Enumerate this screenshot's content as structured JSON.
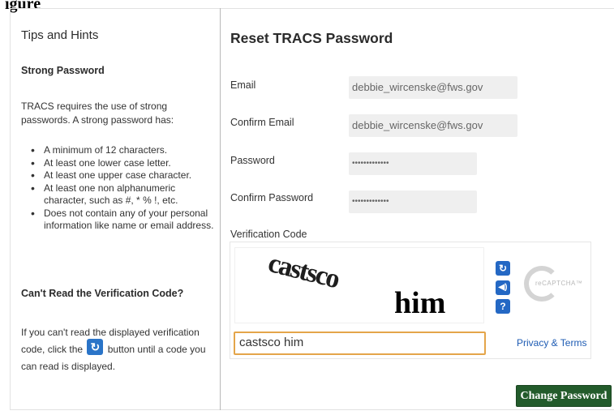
{
  "figure_label": "igure",
  "sidebar": {
    "title": "Tips and Hints",
    "strong_title": "Strong Password",
    "intro": "TRACS requires the use of strong passwords. A strong password has:",
    "bullets": [
      "A minimum of 12 characters.",
      "At least one lower case letter.",
      "At least one upper case character.",
      "At least one non alphanumeric character, such as #, * % !, etc.",
      "Does not contain any of your personal information like name or email address."
    ],
    "cant_read_title": "Can't Read the Verification Code?",
    "help_before": "If you can't read the displayed verification code, click the",
    "help_after": "button until a code you can read is displayed.",
    "refresh_icon": "refresh-icon"
  },
  "form": {
    "title": "Reset TRACS Password",
    "email_label": "Email",
    "email_value": "debbie_wircenske@fws.gov",
    "confirm_email_label": "Confirm Email",
    "confirm_email_value": "debbie_wircenske@fws.gov",
    "password_label": "Password",
    "password_value": "•••••••••••••",
    "confirm_password_label": "Confirm Password",
    "confirm_password_value": "•••••••••••••",
    "verification_label": "Verification Code",
    "captcha_word1": "castsco",
    "captcha_word2": "him",
    "captcha_answer": "castsco him",
    "captcha_icons": [
      "refresh-icon",
      "audio-icon",
      "help-icon"
    ],
    "recaptcha_text": "reCAPTCHA™",
    "privacy_link": "Privacy & Terms",
    "submit_label": "Change Password"
  },
  "colors": {
    "submit_bg": "#235b2b",
    "captcha_button": "#2468c4",
    "input_focus_border": "#e4a54a",
    "link": "#1d5bb3"
  }
}
